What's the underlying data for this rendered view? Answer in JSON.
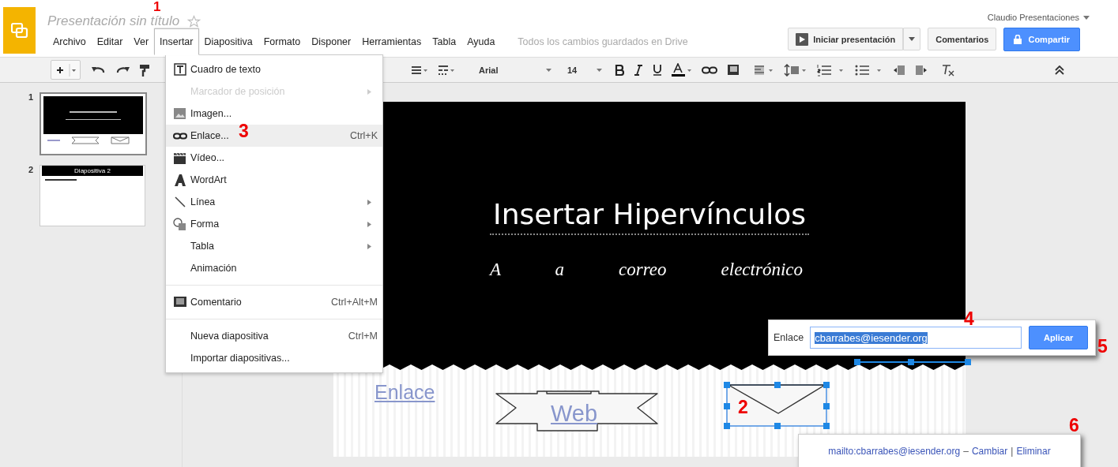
{
  "header": {
    "doc_title": "Presentación sin título",
    "user": "Claudio Presentaciones",
    "save_status": "Todos los cambios guardados en Drive"
  },
  "menubar": [
    {
      "label": "Archivo",
      "selected": false
    },
    {
      "label": "Editar",
      "selected": false
    },
    {
      "label": "Ver",
      "selected": false
    },
    {
      "label": "Insertar",
      "selected": true
    },
    {
      "label": "Diapositiva",
      "selected": false
    },
    {
      "label": "Formato",
      "selected": false
    },
    {
      "label": "Disponer",
      "selected": false
    },
    {
      "label": "Herramientas",
      "selected": false
    },
    {
      "label": "Tabla",
      "selected": false
    },
    {
      "label": "Ayuda",
      "selected": false
    }
  ],
  "header_buttons": {
    "present": "Iniciar presentación",
    "comments": "Comentarios",
    "share": "Compartir"
  },
  "toolbar": {
    "font": "Arial",
    "size": "14"
  },
  "insert_menu": [
    [
      {
        "label": "Cuadro de texto",
        "disabled": false,
        "submenu": false,
        "selected": false
      },
      {
        "label": "Marcador de posición",
        "disabled": true,
        "submenu": true,
        "selected": false
      },
      {
        "label": "Imagen...",
        "disabled": false,
        "submenu": false,
        "selected": false
      },
      {
        "label": "Enlace...",
        "shortcut": "Ctrl+K",
        "disabled": false,
        "submenu": false,
        "selected": true
      },
      {
        "label": "Vídeo...",
        "disabled": false,
        "submenu": false,
        "selected": false
      },
      {
        "label": "WordArt",
        "disabled": false,
        "submenu": false,
        "selected": false
      },
      {
        "label": "Línea",
        "disabled": false,
        "submenu": true,
        "selected": false
      },
      {
        "label": "Forma",
        "disabled": false,
        "submenu": true,
        "selected": false
      },
      {
        "label": "Tabla",
        "disabled": false,
        "submenu": true,
        "selected": false
      },
      {
        "label": "Animación",
        "disabled": false,
        "submenu": false,
        "selected": false
      }
    ],
    [
      {
        "label": "Comentario",
        "shortcut": "Ctrl+Alt+M",
        "disabled": false,
        "submenu": false,
        "selected": false
      }
    ],
    [
      {
        "label": "Nueva diapositiva",
        "shortcut": "Ctrl+M",
        "disabled": false,
        "submenu": false,
        "selected": false
      },
      {
        "label": "Importar diapositivas...",
        "disabled": false,
        "submenu": false,
        "selected": false
      }
    ]
  ],
  "slides": [
    {
      "number": "1",
      "selected": true
    },
    {
      "number": "2",
      "selected": false,
      "title": "Diapositiva 2"
    }
  ],
  "slide": {
    "title": "Insertar Hipervínculos",
    "subtitle": "A a correo electrónico",
    "links": [
      "Enlace",
      "Web"
    ]
  },
  "link_popup": {
    "label": "Enlace",
    "value": "cbarrabes@iesender.org",
    "button": "Aplicar"
  },
  "link_bubble": {
    "url": "mailto:cbarrabes@iesender.org",
    "dash": "–",
    "change": "Cambiar",
    "sep": "|",
    "remove": "Eliminar"
  },
  "annotations": [
    "1",
    "2",
    "3",
    "4",
    "5",
    "6"
  ]
}
